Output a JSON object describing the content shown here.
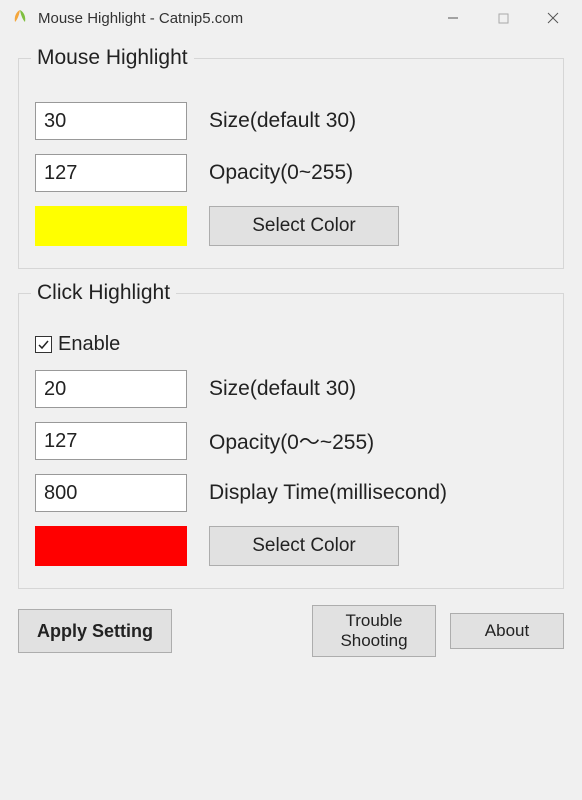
{
  "window": {
    "title": "Mouse Highlight - Catnip5.com"
  },
  "mouseHighlight": {
    "legend": "Mouse Highlight",
    "size": "30",
    "sizeLabel": "Size(default 30)",
    "opacity": "127",
    "opacityLabel": "Opacity(0~255)",
    "color": "#ffff00",
    "selectColorLabel": "Select Color"
  },
  "clickHighlight": {
    "legend": "Click Highlight",
    "enableLabel": "Enable",
    "enabled": true,
    "size": "20",
    "sizeLabel": "Size(default 30)",
    "opacity": "127",
    "opacityLabel": "Opacity(0～~255)",
    "displayTime": "800",
    "displayTimeLabel": "Display Time(millisecond)",
    "color": "#ff0000",
    "selectColorLabel": "Select Color"
  },
  "footer": {
    "applyLabel": "Apply Setting",
    "troubleLabel": "Trouble\nShooting",
    "aboutLabel": "About"
  }
}
